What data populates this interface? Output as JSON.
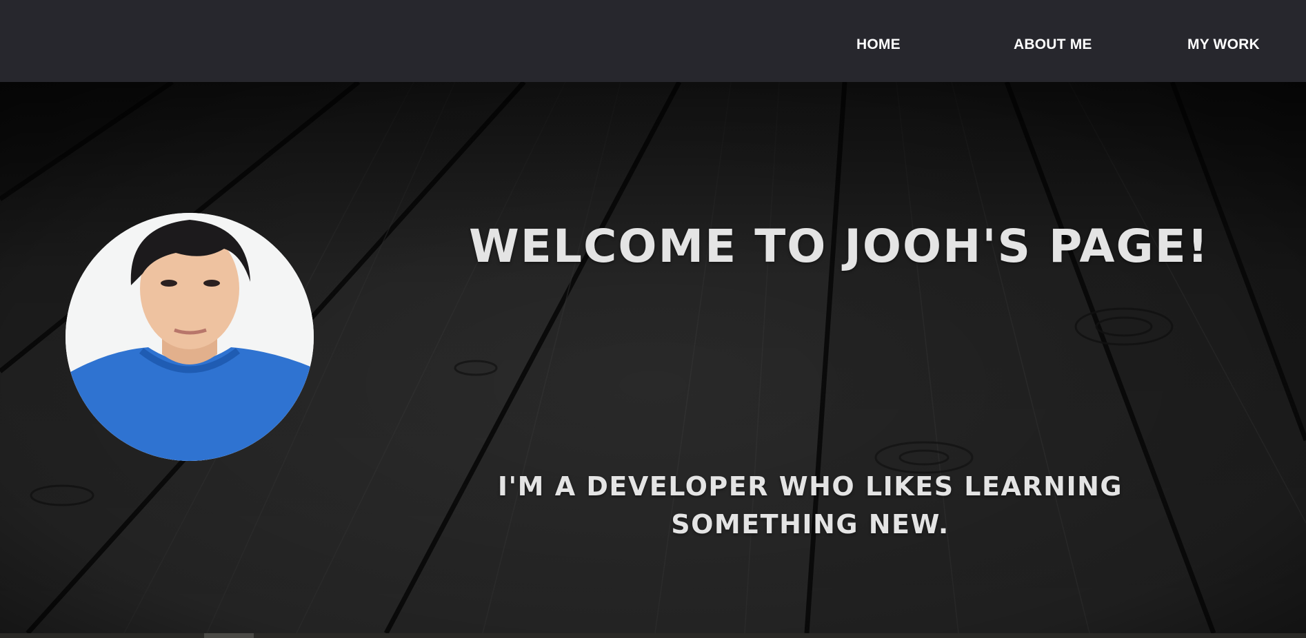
{
  "nav": {
    "home_label": "HOME",
    "about_label": "ABOUT ME",
    "work_label": "MY WORK"
  },
  "hero": {
    "headline": "WELCOME TO JOOH'S PAGE!",
    "tagline": "I'M A DEVELOPER WHO LIKES LEARNING SOMETHING NEW."
  },
  "colors": {
    "navbar_bg": "#27272d",
    "nav_text": "#ffffff",
    "hero_text": "#e4e4e4",
    "shirt_blue": "#2f73d1"
  }
}
